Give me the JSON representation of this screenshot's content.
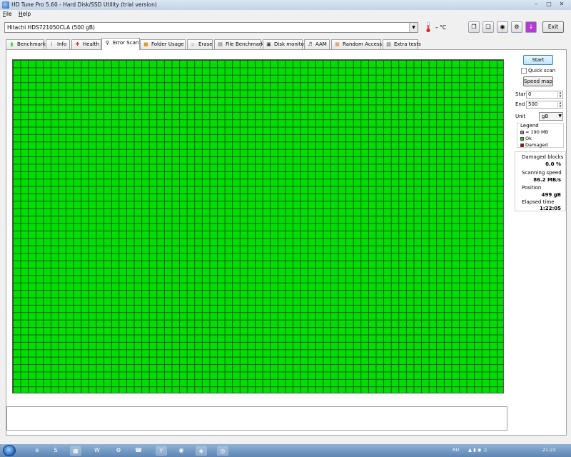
{
  "window": {
    "title": "HD Tune Pro 5.60 - Hard Disk/SSD Utility (trial version)",
    "minimize_icon": "minimize-icon",
    "maximize_icon": "maximize-icon",
    "close_icon": "close-icon"
  },
  "menu": [
    {
      "label": "File",
      "accel": "F",
      "rest": "ile"
    },
    {
      "label": "Help",
      "accel": "H",
      "rest": "elp"
    }
  ],
  "toolbar": {
    "drive": "Hitachi HDS721050CLA (500 gB)",
    "temperature": "– °C",
    "exit_label": "Exit",
    "icons": [
      "copy-icon",
      "paste-icon",
      "camera-icon",
      "options-icon",
      "download-icon"
    ]
  },
  "tabs": [
    {
      "label": "Benchmark",
      "icon": "benchmark-icon",
      "active": false
    },
    {
      "label": "Info",
      "icon": "info-icon",
      "active": false
    },
    {
      "label": "Health",
      "icon": "health-icon",
      "active": false
    },
    {
      "label": "Error Scan",
      "icon": "magnifier-icon",
      "active": true
    },
    {
      "label": "Folder Usage",
      "icon": "folder-icon",
      "active": false
    },
    {
      "label": "Erase",
      "icon": "erase-icon",
      "active": false
    },
    {
      "label": "File Benchmark",
      "icon": "file-benchmark-icon",
      "active": false
    },
    {
      "label": "Disk monitor",
      "icon": "disk-monitor-icon",
      "active": false
    },
    {
      "label": "AAM",
      "icon": "speaker-icon",
      "active": false
    },
    {
      "label": "Random Access",
      "icon": "random-access-icon",
      "active": false
    },
    {
      "label": "Extra tests",
      "icon": "extra-tests-icon",
      "active": false
    }
  ],
  "scan": {
    "start_button": "Start",
    "quick_scan_label": "Quick scan",
    "quick_scan_checked": false,
    "speed_map_button": "Speed map",
    "start_label": "Start",
    "start_value": "0",
    "end_label": "End",
    "end_value": "500",
    "unit_label": "Unit",
    "unit_value": "gB",
    "block_status": "ok",
    "colors": {
      "ok": "#00dd00",
      "damaged": "#c00000",
      "block": "#909090",
      "gridline": "#1a5a1a"
    }
  },
  "legend": {
    "title": "Legend",
    "block_size": "= 190 MB",
    "ok": "Ok",
    "damaged": "Damaged"
  },
  "stats": {
    "damaged_label": "Damaged blocks",
    "damaged_value": "0.0 %",
    "speed_label": "Scanning speed",
    "speed_value": "86.2 MB/s",
    "position_label": "Position",
    "position_value": "499 gB",
    "elapsed_label": "Elapsed time",
    "elapsed_value": "1:22:05"
  },
  "taskbar": {
    "language": "RU",
    "clock": "21:22",
    "apps": [
      "ie-icon",
      "skype-icon",
      "save-icon",
      "word-icon",
      "gear-icon",
      "viber-icon",
      "yandex-icon",
      "media-icon",
      "hdtune-icon",
      "cd-icon"
    ]
  }
}
